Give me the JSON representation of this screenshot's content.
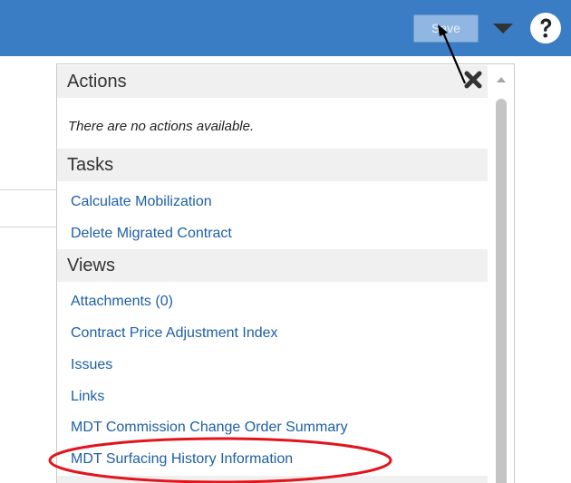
{
  "toolbar": {
    "save_label": "Save",
    "menu_icon": "caret-down-icon",
    "help_icon": "question-circle-icon"
  },
  "panel": {
    "close_icon": "close-x-icon",
    "actions": {
      "heading": "Actions",
      "empty_message": "There are no actions available."
    },
    "tasks": {
      "heading": "Tasks",
      "items": [
        "Calculate Mobilization",
        "Delete Migrated Contract"
      ]
    },
    "views": {
      "heading": "Views",
      "items": [
        "Attachments (0)",
        "Contract Price Adjustment Index",
        "Issues",
        "Links",
        "MDT Commission Change Order Summary",
        "MDT Surfacing History Information"
      ]
    }
  },
  "annotation": {
    "highlight_color": "#e3141b",
    "pointer_color": "#000000"
  }
}
